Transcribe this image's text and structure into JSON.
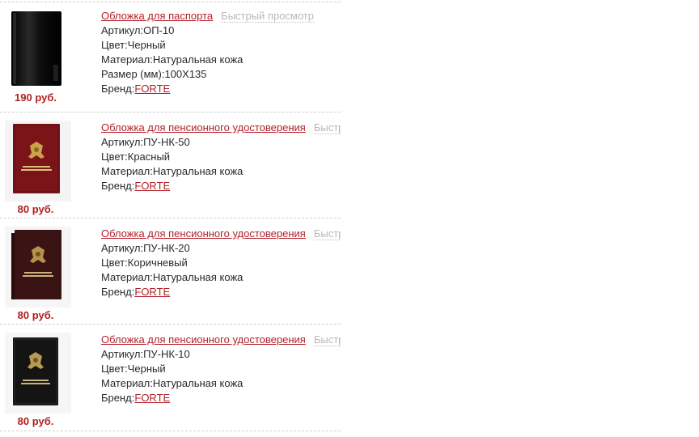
{
  "products": [
    {
      "title": "Обложка для паспорта",
      "quick_view": "Быстрый просмотр",
      "article_label": "Артикул:",
      "article": "ОП-10",
      "color_label": "Цвет:",
      "color": "Черный",
      "material_label": "Материал:",
      "material": "Натуральная кожа",
      "size_label": "Размер (мм):",
      "size": "100Х135",
      "brand_label": "Бренд:",
      "brand": "FORTE",
      "price": "190 руб.",
      "cover_color": "#111111",
      "image_kind": "passport-cover-black"
    },
    {
      "title": "Обложка для пенсионного удостоверения",
      "quick_view": "Быстрый просмотр",
      "article_label": "Артикул:",
      "article": "ПУ-НК-50",
      "color_label": "Цвет:",
      "color": "Красный",
      "material_label": "Материал:",
      "material": "Натуральная кожа",
      "brand_label": "Бренд:",
      "brand": "FORTE",
      "price": "80 руб.",
      "cover_color": "#7a1418",
      "image_kind": "pension-cover-red"
    },
    {
      "title": "Обложка для пенсионного удостоверения",
      "quick_view": "Быстрый просмотр",
      "article_label": "Артикул:",
      "article": "ПУ-НК-20",
      "color_label": "Цвет:",
      "color": "Коричневый",
      "material_label": "Материал:",
      "material": "Натуральная кожа",
      "brand_label": "Бренд:",
      "brand": "FORTE",
      "price": "80 руб.",
      "cover_color": "#3a1314",
      "image_kind": "pension-cover-brown"
    },
    {
      "title": "Обложка для пенсионного удостоверения",
      "quick_view": "Быстрый просмотр",
      "article_label": "Артикул:",
      "article": "ПУ-НК-10",
      "color_label": "Цвет:",
      "color": "Черный",
      "material_label": "Материал:",
      "material": "Натуральная кожа",
      "brand_label": "Бренд:",
      "brand": "FORTE",
      "price": "80 руб.",
      "cover_color": "#141414",
      "image_kind": "pension-cover-black"
    }
  ],
  "colors": {
    "link": "#b3202a",
    "price": "#b01e1e",
    "quick_view": "#b8b8b8",
    "divider": "#cfcfcf"
  }
}
